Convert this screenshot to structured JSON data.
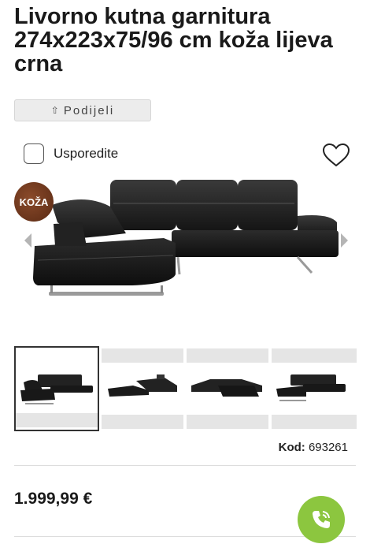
{
  "product": {
    "title": "Livorno kutna garnitura 274x223x75/96 cm koža lijeva crna",
    "badge": "KOŽA",
    "code_label": "Kod:",
    "code_value": "693261",
    "price": "1.999,99 €"
  },
  "actions": {
    "share_label": "Podijeli",
    "compare_label": "Usporedite"
  },
  "gallery": {
    "thumbnail_count": 4,
    "selected_index": 0
  },
  "icons": {
    "share": "share-icon",
    "heart": "heart-icon",
    "phone": "phone-icon",
    "prev": "chevron-left-icon",
    "next": "chevron-right-icon"
  },
  "colors": {
    "call_button": "#8cc63f",
    "share_button_bg": "#ececec",
    "badge": "#6b3a20"
  }
}
